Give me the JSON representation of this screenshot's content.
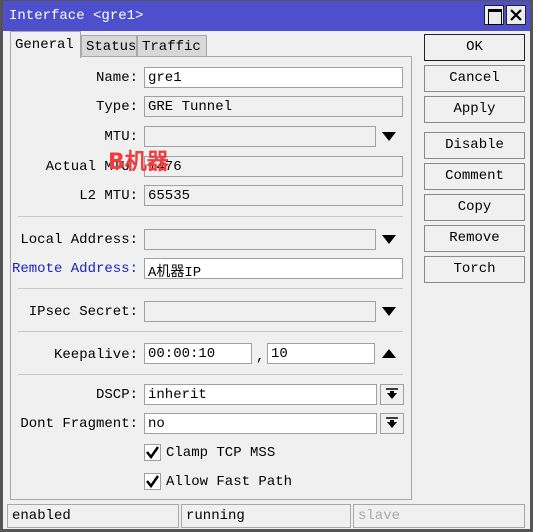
{
  "window": {
    "title": "Interface <gre1>",
    "maximize_icon": "maximize-icon",
    "close_icon": "close-icon"
  },
  "tabs": [
    {
      "label": "General",
      "active": true
    },
    {
      "label": "Status",
      "active": false
    },
    {
      "label": "Traffic",
      "active": false
    }
  ],
  "overlay_annotation": "B机器",
  "form": {
    "name": {
      "label": "Name:",
      "value": "gre1"
    },
    "type": {
      "label": "Type:",
      "value": "GRE Tunnel"
    },
    "mtu": {
      "label": "MTU:",
      "value": ""
    },
    "actual_mtu": {
      "label": "Actual MTU:",
      "value": "1476"
    },
    "l2_mtu": {
      "label": "L2 MTU:",
      "value": "65535"
    },
    "local_address": {
      "label": "Local Address:",
      "value": ""
    },
    "remote_address": {
      "label": "Remote Address:",
      "value": "A机器IP"
    },
    "ipsec_secret": {
      "label": "IPsec Secret:",
      "value": ""
    },
    "keepalive": {
      "label": "Keepalive:",
      "interval": "00:00:10",
      "separator": ",",
      "retries": "10"
    },
    "dscp": {
      "label": "DSCP:",
      "value": "inherit"
    },
    "dont_fragment": {
      "label": "Dont Fragment:",
      "value": "no"
    },
    "clamp_tcp_mss": {
      "label": "Clamp TCP MSS",
      "checked": true
    },
    "allow_fast_path": {
      "label": "Allow Fast Path",
      "checked": true
    }
  },
  "buttons": {
    "ok": "OK",
    "cancel": "Cancel",
    "apply": "Apply",
    "disable": "Disable",
    "comment": "Comment",
    "copy": "Copy",
    "remove": "Remove",
    "torch": "Torch"
  },
  "statusbar": {
    "enabled": "enabled",
    "running": "running",
    "slave": "slave"
  }
}
